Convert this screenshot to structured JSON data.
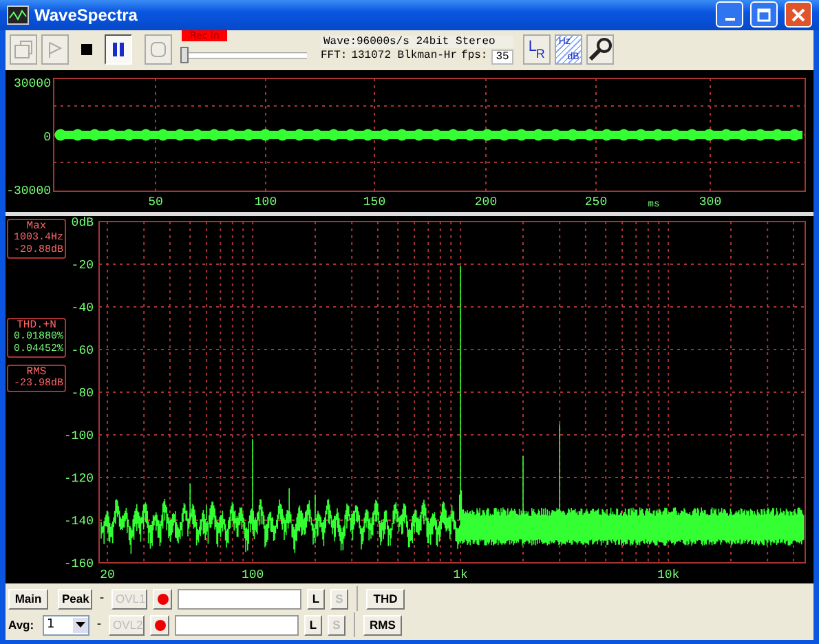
{
  "window": {
    "title": "WaveSpectra"
  },
  "toolbar": {
    "transport": [
      {
        "kind": "open",
        "disabled": true,
        "pressed": false
      },
      {
        "kind": "play",
        "disabled": true,
        "pressed": false
      },
      {
        "kind": "stop",
        "disabled": false,
        "pressed": false
      },
      {
        "kind": "pause",
        "disabled": false,
        "pressed": true
      },
      {
        "kind": "record",
        "disabled": true,
        "pressed": false
      }
    ],
    "rec_label": "Rec In",
    "slider": {
      "level": 0
    },
    "wave_info": "Wave:96000s/s 24bit Stereo",
    "fft_label": "FFT:",
    "fft_info": "131072 Blkman-Hr",
    "fps_label": "fps:",
    "fps": "35",
    "lr_button": {
      "left": "L",
      "right": "R"
    },
    "unit_button": {
      "top": "Hz",
      "bottom": "dB"
    }
  },
  "wave_panel": {
    "yticks": [
      "30000",
      "0",
      "-30000"
    ],
    "xticks": [
      "50",
      "100",
      "150",
      "200",
      "250",
      "300"
    ],
    "unit": "ms"
  },
  "spectrum_panel": {
    "yticks": [
      "0dB",
      "-20",
      "-40",
      "-60",
      "-80",
      "-100",
      "-120",
      "-140",
      "-160"
    ],
    "xticks": [
      "20",
      "100",
      "1k",
      "10k"
    ],
    "readouts": [
      {
        "title": "Max",
        "lines": [
          "1003.4Hz",
          "-20.88dB"
        ]
      },
      {
        "title": "THD.+N",
        "lines": [
          "0.01880%",
          "0.04452%"
        ]
      },
      {
        "title": "RMS",
        "lines": [
          "-23.98dB"
        ]
      }
    ]
  },
  "channels": [
    {
      "kind": "button",
      "label": "Main",
      "mode": "Peak",
      "dash": "-",
      "overload": {
        "label": "OVL1",
        "disabled": true
      },
      "l": {
        "label": "L",
        "disabled": false
      },
      "s": {
        "label": "S",
        "disabled": true
      },
      "meter": "THD"
    },
    {
      "kind": "select",
      "label": "Avg:",
      "value": "1",
      "dash": "-",
      "overload": {
        "label": "OVL2",
        "disabled": true
      },
      "l": {
        "label": "L",
        "disabled": false
      },
      "s": {
        "label": "S",
        "disabled": true
      },
      "meter": "RMS"
    }
  ]
}
